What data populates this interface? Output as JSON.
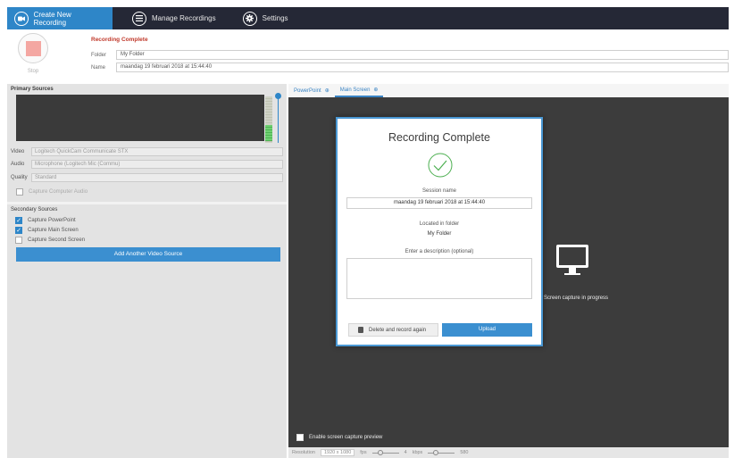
{
  "nav": {
    "tabs": [
      {
        "label": "Create New Recording",
        "icon": "camera-icon",
        "active": true
      },
      {
        "label": "Manage Recordings",
        "icon": "list-icon",
        "active": false
      },
      {
        "label": "Settings",
        "icon": "gear-icon",
        "active": false
      }
    ]
  },
  "header": {
    "stop_label": "Stop",
    "status_title": "Recording Complete",
    "folder_label": "Folder",
    "folder_value": "My Folder",
    "name_label": "Name",
    "name_value": "maandag 19 februari 2018 at 15:44:40"
  },
  "primary_sources": {
    "heading": "Primary Sources",
    "video_label": "Video",
    "video_value": "Logitech QuickCam Communicate STX",
    "audio_label": "Audio",
    "audio_value": "Microphone (Logitech Mic (Commu)",
    "quality_label": "Quality",
    "quality_value": "Standard",
    "capture_audio_label": "Capture Computer Audio"
  },
  "secondary_sources": {
    "heading": "Secondary Sources",
    "items": [
      {
        "label": "Capture PowerPoint",
        "checked": true
      },
      {
        "label": "Capture Main Screen",
        "checked": true
      },
      {
        "label": "Capture Second Screen",
        "checked": false
      }
    ],
    "add_button": "Add Another Video Source"
  },
  "preview_tabs": [
    {
      "label": "PowerPoint",
      "icon": "add-icon"
    },
    {
      "label": "Main Screen",
      "icon": "add-icon",
      "active": true
    }
  ],
  "screen_capture_text": "Screen capture in progress",
  "enable_preview_label": "Enable screen capture preview",
  "status_bar": {
    "resolution_label": "Resolution",
    "resolution_value": "1920 x 1080",
    "fps_label": "fps",
    "fps_value": "4",
    "kbps_label": "kbps",
    "kbps_value": "580"
  },
  "modal": {
    "title": "Recording Complete",
    "session_label": "Session name",
    "session_value": "maandag 19 februari 2018 at 15:44:40",
    "located_label": "Located in folder",
    "folder_value": "My Folder",
    "description_label": "Enter a description (optional)",
    "delete_button": "Delete and record again",
    "upload_button": "Upload"
  },
  "colors": {
    "nav_bg": "#252836",
    "accent": "#2e86c8",
    "danger": "#c0392b"
  }
}
